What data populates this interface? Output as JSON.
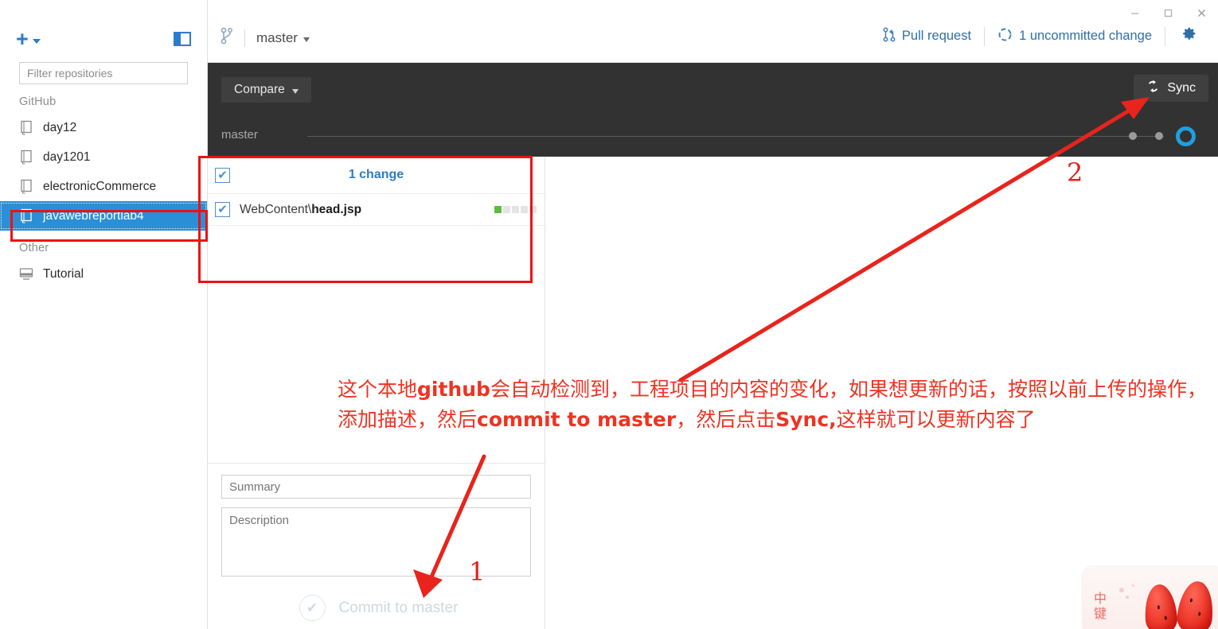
{
  "window": {
    "controls": [
      {
        "name": "minimize",
        "glyph": "minimize-icon"
      },
      {
        "name": "maximize",
        "glyph": "maximize-icon"
      },
      {
        "name": "close",
        "glyph": "close-icon"
      }
    ]
  },
  "sidebar": {
    "add_button_label": "+",
    "panel_toggle_name": "toggle-sidebar-icon",
    "filter": {
      "placeholder": "Filter repositories",
      "value": ""
    },
    "groups": [
      {
        "label": "GitHub",
        "items": [
          {
            "label": "day12",
            "icon": "repository-icon",
            "selected": false
          },
          {
            "label": "day1201",
            "icon": "repository-icon",
            "selected": false
          },
          {
            "label": "electronicCommerce",
            "icon": "repository-icon",
            "selected": false
          },
          {
            "label": "javawebreportlab4",
            "icon": "repository-icon",
            "selected": true
          }
        ]
      },
      {
        "label": "Other",
        "items": [
          {
            "label": "Tutorial",
            "icon": "monitor-icon",
            "selected": false
          }
        ]
      }
    ]
  },
  "topbar": {
    "branch_icon": "branch-icon",
    "branch_name": "master",
    "pull_request_label": "Pull request",
    "pull_request_icon": "pull-request-icon",
    "uncommitted_label": "1 uncommitted change",
    "uncommitted_icon": "sync-status-icon",
    "settings_icon": "gear-icon"
  },
  "toolbar": {
    "compare_label": "Compare",
    "sync_label": "Sync",
    "sync_icon": "sync-icon",
    "timeline_label": "master"
  },
  "changes": {
    "select_all_checked": true,
    "count_label": "1 change",
    "files": [
      {
        "path_prefix": "WebContent\\",
        "path_file": "head.jsp",
        "checked": true,
        "diff": [
          "add",
          "none",
          "none",
          "none",
          "none"
        ]
      }
    ]
  },
  "commit": {
    "summary_placeholder": "Summary",
    "summary_value": "",
    "description_placeholder": "Description",
    "description_value": "",
    "button_label": "Commit to master",
    "button_icon": "check-circle-icon"
  },
  "annotations": {
    "note_line1_a": "这个本地",
    "note_line1_b": "github",
    "note_line1_c": "会自动检测到，工程项目的内容的变化，如果想更新的话，按照以前",
    "note_line2_a": "上传的操作，添加描述，然后",
    "note_line2_b": "commit to master",
    "note_line2_c": "，然后点击",
    "note_line2_d": "Sync,",
    "note_line2_e": "这样就可以更新内",
    "note_line3": "容了",
    "marker_1": "1",
    "marker_2": "2",
    "color": "#ee3322"
  },
  "ime": {
    "line1": "中",
    "line2": "键"
  },
  "colors": {
    "accent_blue": "#2b7bd0",
    "selection_blue": "#2a8fd6",
    "dark_toolbar": "#323232",
    "annotation_red": "#ee1111",
    "diff_add_green": "#5bbd3f",
    "timeline_ring": "#1f9fe0"
  }
}
